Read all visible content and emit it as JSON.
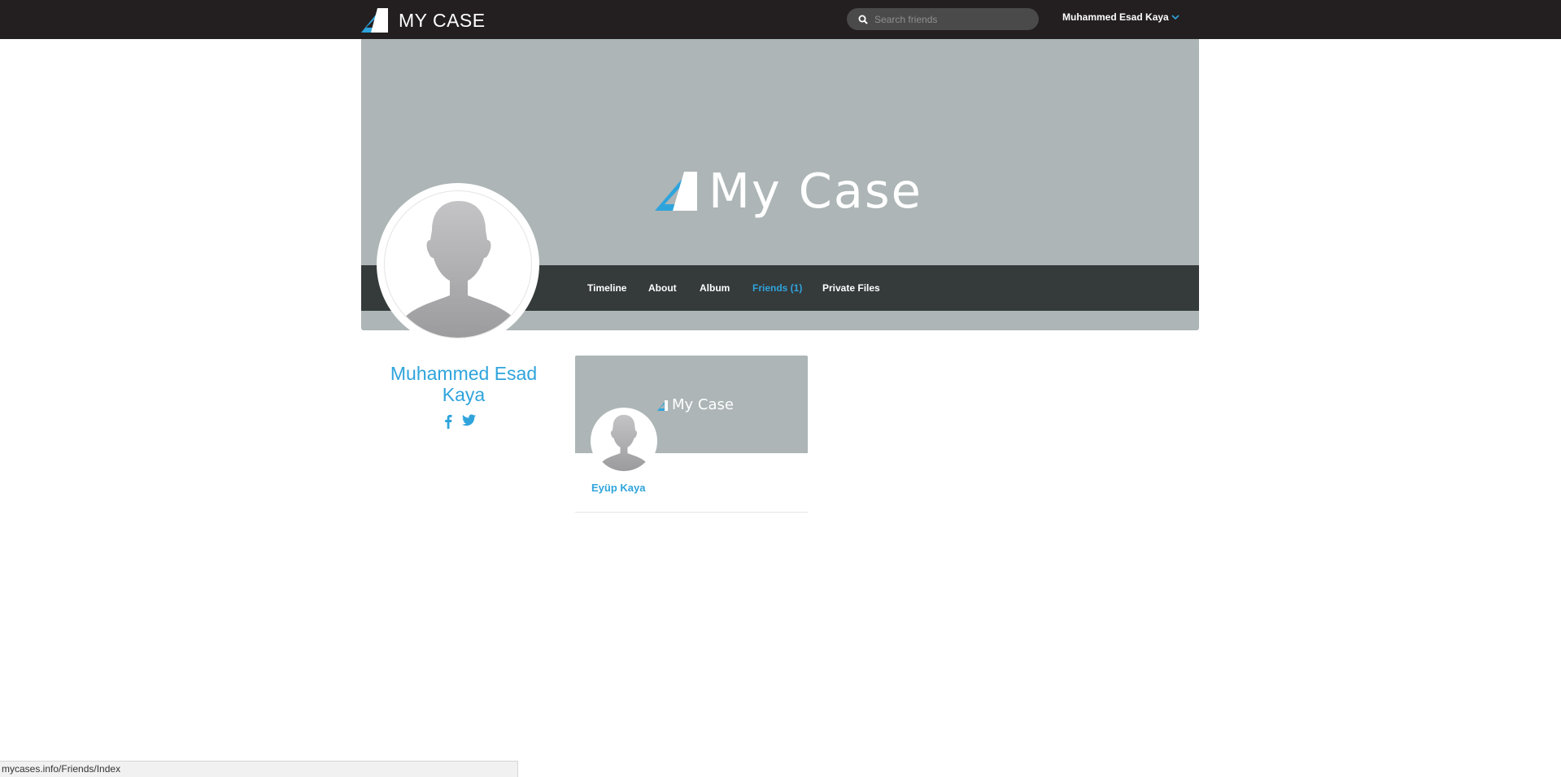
{
  "topbar": {
    "brand": "MY CASE",
    "search_placeholder": "Search friends",
    "user_name": "Muhammed Esad Kaya",
    "logo_icon": "mycase-logo-icon",
    "search_icon": "search-icon",
    "dropdown_icon": "chevron-down-icon"
  },
  "cover": {
    "brand_text": "My Case"
  },
  "profile_nav": {
    "items": [
      {
        "label": "Timeline"
      },
      {
        "label": "About"
      },
      {
        "label": "Album"
      },
      {
        "label": "Friends (1)",
        "active": true
      },
      {
        "label": "Private Files"
      }
    ]
  },
  "profile": {
    "name": "Muhammed Esad Kaya",
    "social_icons": [
      "facebook-icon",
      "twitter-icon"
    ]
  },
  "friends": [
    {
      "name": "Eyüp Kaya",
      "cover_brand": "My Case"
    }
  ],
  "status_bar": {
    "url": "mycases.info/Friends/Index"
  },
  "colors": {
    "topbar_bg": "#231f20",
    "cover_bg": "#adb5b6",
    "nav_bg": "#353a3b",
    "accent": "#2fa4dc"
  }
}
